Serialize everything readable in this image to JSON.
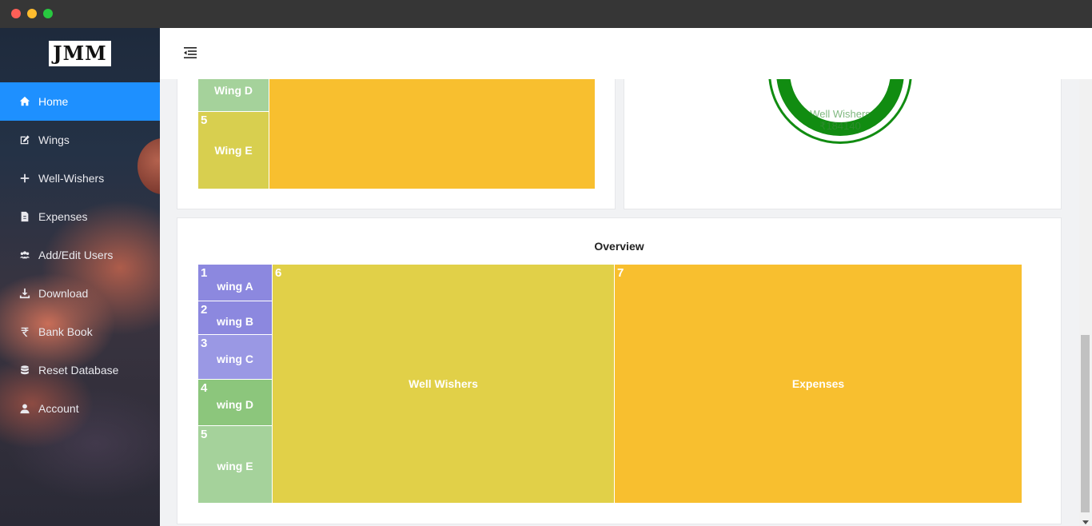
{
  "window": {
    "controls": [
      "close",
      "minimize",
      "maximize"
    ]
  },
  "sidebar": {
    "logo_text": "JMM",
    "items": [
      {
        "label": "Home",
        "icon": "home-icon",
        "active": true
      },
      {
        "label": "Wings",
        "icon": "edit-icon",
        "active": false
      },
      {
        "label": "Well-Wishers",
        "icon": "plus-icon",
        "active": false
      },
      {
        "label": "Expenses",
        "icon": "file-icon",
        "active": false
      },
      {
        "label": "Add/Edit Users",
        "icon": "users-icon",
        "active": false
      },
      {
        "label": "Download",
        "icon": "download-icon",
        "active": false
      },
      {
        "label": "Bank Book",
        "icon": "rupee-icon",
        "active": false
      },
      {
        "label": "Reset Database",
        "icon": "database-icon",
        "active": false
      },
      {
        "label": "Account",
        "icon": "user-icon",
        "active": false
      }
    ]
  },
  "header": {
    "menu_icon": "menu-collapse-icon"
  },
  "top_left_treemap": {
    "cells": [
      {
        "num": "",
        "label": "Wing D",
        "color": "#a5d29b"
      },
      {
        "num": "5",
        "label": "Wing E",
        "color": "#d8cf4f"
      },
      {
        "num": "",
        "label": "",
        "color": "#f8bf2f"
      }
    ]
  },
  "donut": {
    "partial_label": "Well Wishers",
    "value": "₹184140",
    "color": "#118c11"
  },
  "overview": {
    "title": "Overview",
    "cells": [
      {
        "num": "1",
        "label": "wing A",
        "color": "#8c88df"
      },
      {
        "num": "2",
        "label": "wing B",
        "color": "#8c88df"
      },
      {
        "num": "3",
        "label": "wing C",
        "color": "#9a98e4"
      },
      {
        "num": "4",
        "label": "wing D",
        "color": "#8cc67c"
      },
      {
        "num": "5",
        "label": "wing E",
        "color": "#a5d29b"
      },
      {
        "num": "6",
        "label": "Well Wishers",
        "color": "#e1d048"
      },
      {
        "num": "7",
        "label": "Expenses",
        "color": "#f8bf2f"
      }
    ]
  }
}
